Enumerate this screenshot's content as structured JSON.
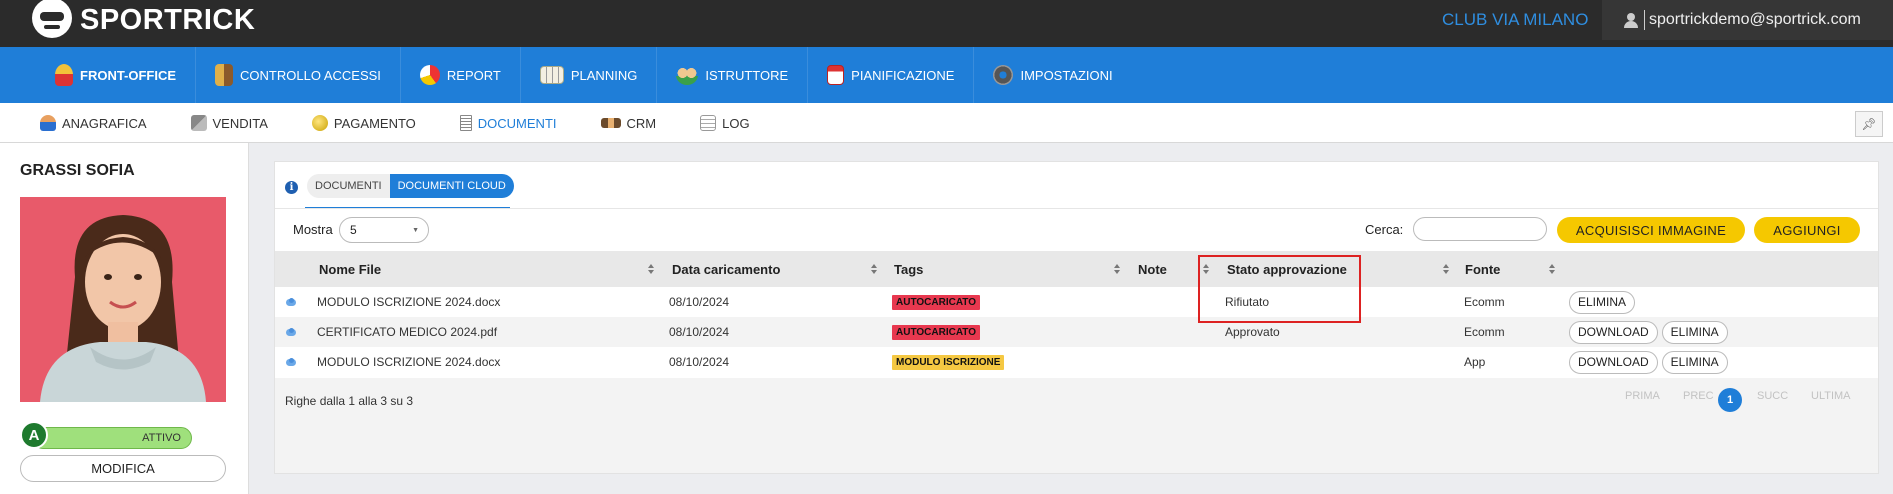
{
  "app": {
    "logo_text": "SPORTRICK",
    "club_name": "CLUB VIA MILANO",
    "user_email": "sportrickdemo@sportrick.com"
  },
  "main_nav": [
    {
      "label": "FRONT-OFFICE",
      "icon": "front-office-icon",
      "active": true
    },
    {
      "label": "CONTROLLO ACCESSI",
      "icon": "access-control-icon",
      "active": false
    },
    {
      "label": "REPORT",
      "icon": "report-pie-icon",
      "active": false
    },
    {
      "label": "PLANNING",
      "icon": "planning-icon",
      "active": false
    },
    {
      "label": "ISTRUTTORE",
      "icon": "instructor-icon",
      "active": false
    },
    {
      "label": "PIANIFICAZIONE",
      "icon": "calendar-icon",
      "active": false
    },
    {
      "label": "IMPOSTAZIONI",
      "icon": "gear-icon",
      "active": false
    }
  ],
  "sub_nav": [
    {
      "label": "ANAGRAFICA",
      "icon": "person-icon",
      "active": false
    },
    {
      "label": "VENDITA",
      "icon": "cash-register-icon",
      "active": false
    },
    {
      "label": "PAGAMENTO",
      "icon": "coin-icon",
      "active": false
    },
    {
      "label": "DOCUMENTI",
      "icon": "document-icon",
      "active": true
    },
    {
      "label": "CRM",
      "icon": "handshake-icon",
      "active": false
    },
    {
      "label": "LOG",
      "icon": "log-icon",
      "active": false
    }
  ],
  "member": {
    "name": "GRASSI SOFIA",
    "status_letter": "A",
    "status_label": "ATTIVO",
    "edit_label": "MODIFICA"
  },
  "documents": {
    "tabs": [
      {
        "label": "DOCUMENTI",
        "active": false
      },
      {
        "label": "DOCUMENTI CLOUD",
        "active": true
      }
    ],
    "show_label": "Mostra",
    "show_value": "5",
    "search_label": "Cerca:",
    "search_placeholder": "",
    "acquire_label": "ACQUISISCI IMMAGINE",
    "add_label": "AGGIUNGI",
    "columns": [
      "Nome File",
      "Data caricamento",
      "Tags",
      "Note",
      "Stato approvazione",
      "Fonte"
    ],
    "rows": [
      {
        "file": "MODULO ISCRIZIONE 2024.docx",
        "date": "08/10/2024",
        "tag": "AUTOCARICATO",
        "tag_color": "#e8384f",
        "note": "",
        "status": "Rifiutato",
        "source": "Ecomm",
        "actions": [
          "ELIMINA"
        ]
      },
      {
        "file": "CERTIFICATO MEDICO 2024.pdf",
        "date": "08/10/2024",
        "tag": "AUTOCARICATO",
        "tag_color": "#e8384f",
        "note": "",
        "status": "Approvato",
        "source": "Ecomm",
        "actions": [
          "DOWNLOAD",
          "ELIMINA"
        ]
      },
      {
        "file": "MODULO ISCRIZIONE 2024.docx",
        "date": "08/10/2024",
        "tag": "MODULO ISCRIZIONE",
        "tag_color": "#f5c842",
        "note": "",
        "status": "",
        "source": "App",
        "actions": [
          "DOWNLOAD",
          "ELIMINA"
        ]
      }
    ],
    "rows_info": "Righe dalla 1 alla 3 su 3",
    "pager": {
      "first": "PRIMA",
      "prev": "PREC",
      "current": "1",
      "next": "SUCC",
      "last": "ULTIMA"
    }
  },
  "colors": {
    "nav_blue": "#1f7ed8",
    "topbar": "#2b2b2b",
    "accent_yellow": "#f5c800",
    "highlight_red": "#dd2222"
  }
}
